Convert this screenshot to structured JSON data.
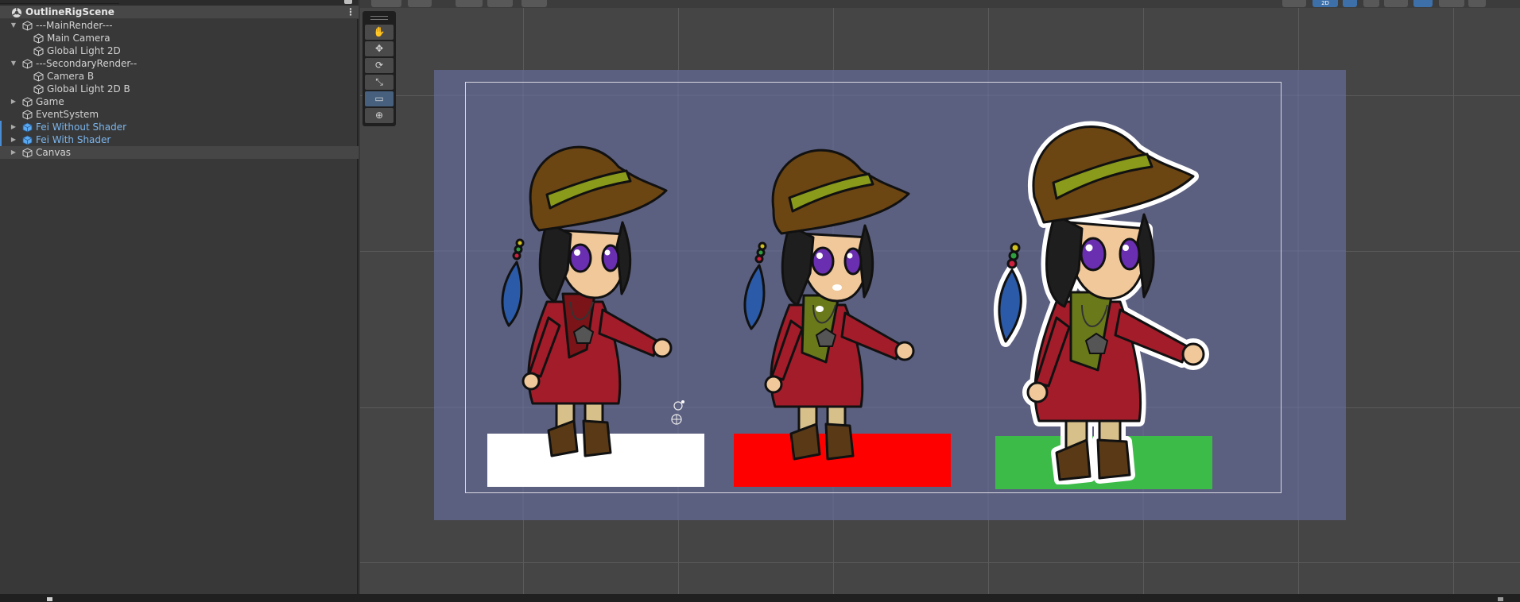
{
  "hierarchy": {
    "scene_name": "OutlineRigScene",
    "items": [
      {
        "label": "---MainRender---",
        "indent": 1,
        "expanded": true
      },
      {
        "label": "Main Camera",
        "indent": 2
      },
      {
        "label": "Global Light 2D",
        "indent": 2
      },
      {
        "label": "---SecondaryRender--",
        "indent": 1,
        "expanded": true
      },
      {
        "label": "Camera B",
        "indent": 2
      },
      {
        "label": "Global Light 2D B",
        "indent": 2
      },
      {
        "label": "Game",
        "indent": 1,
        "collapsed": true
      },
      {
        "label": "EventSystem",
        "indent": 1
      },
      {
        "label": "Fei Without Shader",
        "indent": 1,
        "collapsed": true,
        "prefab": true
      },
      {
        "label": "Fei With Shader",
        "indent": 1,
        "collapsed": true,
        "prefab": true
      },
      {
        "label": "Canvas",
        "indent": 1,
        "collapsed": true,
        "selected": true
      }
    ]
  },
  "scene_view": {
    "toolbar": {
      "mode_2d_label": "2D"
    },
    "tools": [
      "hand-tool",
      "move-tool",
      "rotate-tool",
      "scale-tool",
      "rect-tool",
      "transform-tool"
    ],
    "pads": [
      {
        "name": "white-platform",
        "color": "#ffffff"
      },
      {
        "name": "red-platform",
        "color": "#ff0000"
      },
      {
        "name": "green-platform",
        "color": "#3dbb49"
      }
    ]
  },
  "colors": {
    "camera_bg": "#5c6080",
    "hat": "#6b4512",
    "hat_band": "#8a9a1a",
    "dress": "#a31c2a",
    "skin": "#f0c89a",
    "eyes": "#6a2fb0",
    "hair": "#1e1e1e",
    "scarf_red": "#7a1418",
    "scarf_green": "#6a7a1a",
    "feather": "#2a5aa8",
    "boots": "#5a3a16"
  }
}
